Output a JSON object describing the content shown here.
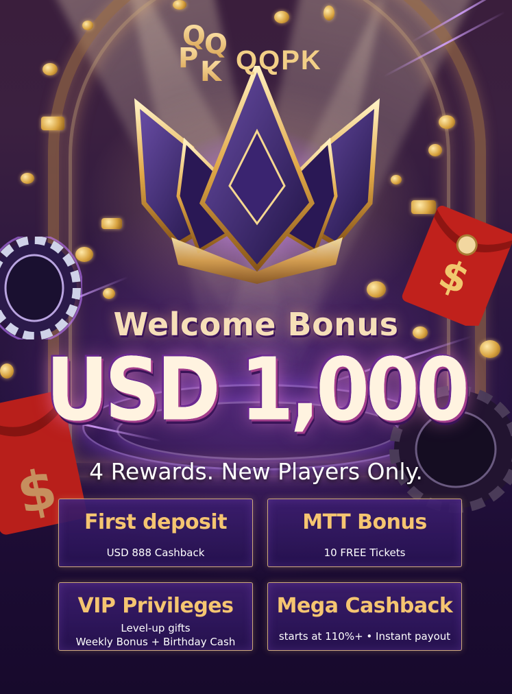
{
  "brand": {
    "name": "QQPK",
    "logo_letters": [
      "Q",
      "Q",
      "P",
      "K"
    ]
  },
  "hero": {
    "headline": "Welcome Bonus",
    "amount": "USD 1,000",
    "subheadline": "4 Rewards. New Players Only."
  },
  "rewards": [
    {
      "title": "First deposit",
      "desc_lines": [
        "USD 888 Cashback"
      ]
    },
    {
      "title": "MTT Bonus",
      "desc_lines": [
        "10 FREE Tickets"
      ]
    },
    {
      "title": "VIP Privileges",
      "desc_lines": [
        "Level-up gifts",
        "Weekly Bonus + Birthday Cash"
      ]
    },
    {
      "title": "Mega Cashback",
      "desc_lines": [
        "starts at 110%+ • Instant payout"
      ]
    }
  ],
  "decor": {
    "icons": [
      "crown-icon",
      "poker-chip-icon",
      "red-envelope-icon",
      "gold-coin-icon"
    ],
    "colors": {
      "gold": "#f5c571",
      "purple": "#3b1f6e",
      "background": "#1a0b2e",
      "envelope": "#c0211c"
    }
  }
}
